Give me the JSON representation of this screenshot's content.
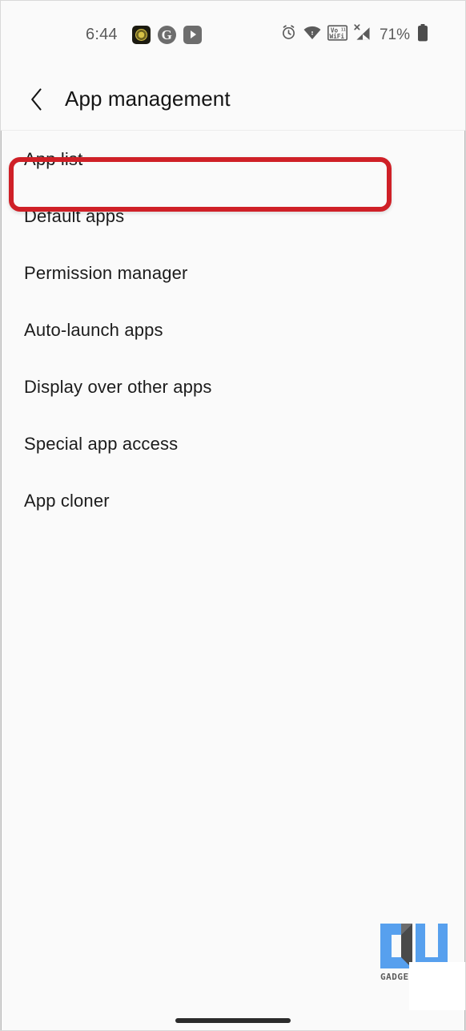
{
  "status_bar": {
    "time": "6:44",
    "notification_icons": [
      {
        "name": "app-badge-icon"
      },
      {
        "name": "google-icon",
        "glyph": "G"
      },
      {
        "name": "youtube-icon"
      }
    ],
    "system_icons": [
      {
        "name": "alarm-clock-icon"
      },
      {
        "name": "wifi-icon"
      },
      {
        "name": "vowifi-icon",
        "line1": "Vo",
        "line2": "WiFi",
        "sup": "LTE"
      },
      {
        "name": "mobile-signal-no-service-icon",
        "badge": "X"
      }
    ],
    "battery_percent": "71%"
  },
  "header": {
    "back_label": "Back",
    "title": "App management"
  },
  "list": {
    "items": [
      {
        "label": "App list",
        "highlighted": true
      },
      {
        "label": "Default apps",
        "highlighted": false
      },
      {
        "label": "Permission manager",
        "highlighted": false
      },
      {
        "label": "Auto-launch apps",
        "highlighted": false
      },
      {
        "label": "Display over other apps",
        "highlighted": false
      },
      {
        "label": "Special app access",
        "highlighted": false
      },
      {
        "label": "App cloner",
        "highlighted": false
      }
    ]
  },
  "annotation": {
    "highlight_color": "#cf2027",
    "target": "App list"
  },
  "watermark": {
    "text": "GADGETSTOUSE",
    "primary_color": "#57a0ee",
    "secondary_color": "#4a4a4a"
  },
  "colors": {
    "background": "#fafafa",
    "text_primary": "#1c1c1c",
    "text_secondary": "#5b5b5b",
    "divider": "#ececec"
  }
}
